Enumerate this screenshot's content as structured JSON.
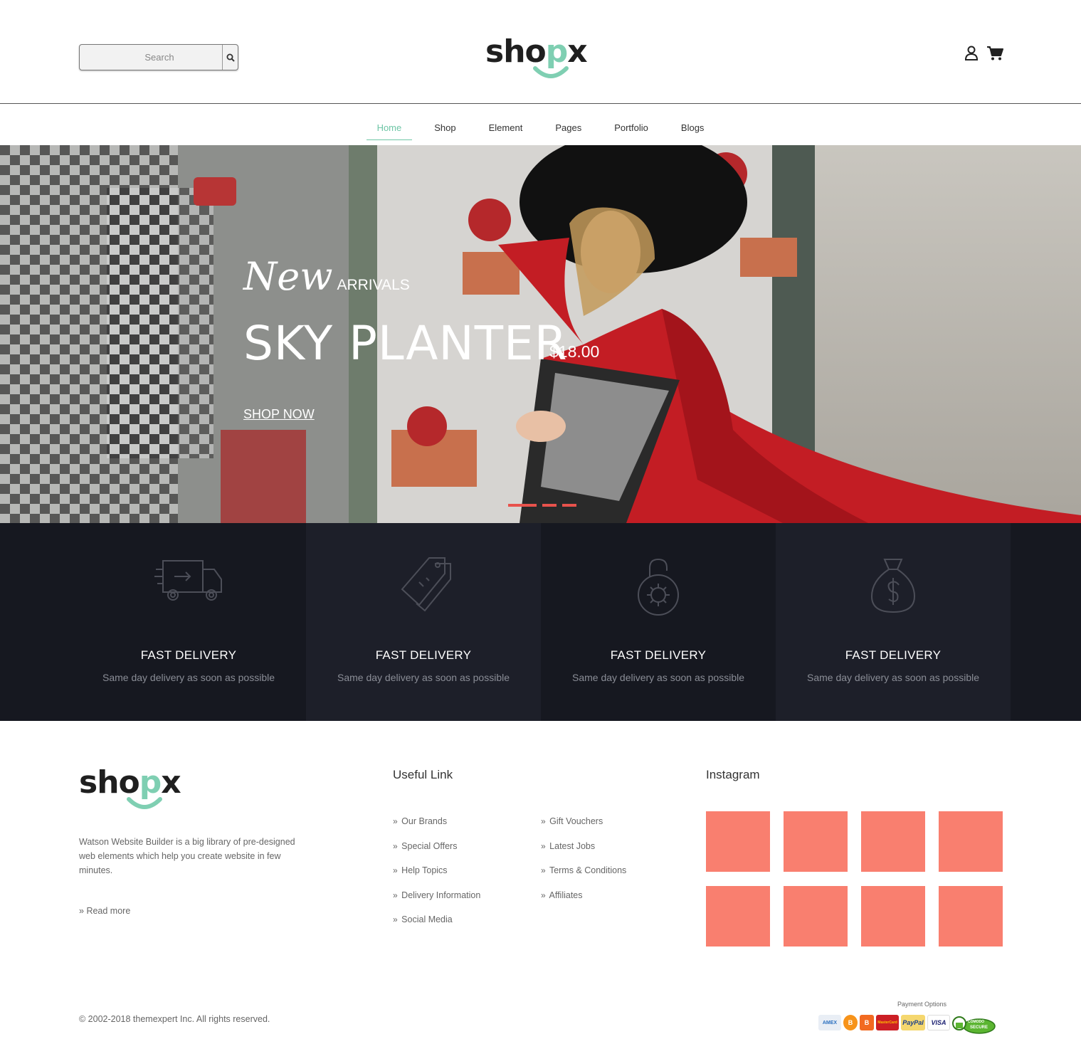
{
  "header": {
    "search_placeholder": "Search",
    "logo": {
      "text_main": "sho",
      "text_green": "p",
      "text_end": "x"
    }
  },
  "nav": {
    "items": [
      {
        "label": "Home",
        "active": true
      },
      {
        "label": "Shop"
      },
      {
        "label": "Element"
      },
      {
        "label": "Pages"
      },
      {
        "label": "Portfolio"
      },
      {
        "label": "Blogs"
      }
    ]
  },
  "hero": {
    "script_word": "New",
    "kicker": "ARRIVALS",
    "title": "SKY PLANTER",
    "price": "$18.00",
    "cta": "SHOP NOW",
    "slides": 3,
    "active_color": "#e8524c"
  },
  "features": [
    {
      "icon": "truck-icon",
      "title": "FAST DELIVERY",
      "desc": "Same day delivery as soon as possible"
    },
    {
      "icon": "tag-icon",
      "title": "FAST DELIVERY",
      "desc": "Same day delivery as soon as possible"
    },
    {
      "icon": "padlock-icon",
      "title": "FAST DELIVERY",
      "desc": "Same day delivery as soon as possible"
    },
    {
      "icon": "money-bag-icon",
      "title": "FAST DELIVERY",
      "desc": "Same day delivery as soon as possible"
    }
  ],
  "footer": {
    "about": "Watson Website Builder is a big library of pre-designed web elements which help you create website in few minutes.",
    "read_more": "Read more",
    "useful_title": "Useful Link",
    "links_col1": [
      "Our Brands",
      "Special Offers",
      "Help Topics",
      "Delivery Information",
      "Social Media"
    ],
    "links_col2": [
      "Gift Vouchers",
      "Latest Jobs",
      "Terms & Conditions",
      "Affiliates"
    ],
    "instagram_title": "Instagram",
    "instagram_tiles": 8,
    "tile_color": "#f97f6f",
    "copyright": "© 2002-2018 themexpert Inc. All rights reserved.",
    "payment_label": "Payment Options",
    "payment_methods": [
      "AMEX",
      "B",
      "B",
      "MasterCard",
      "PayPal",
      "VISA"
    ],
    "badge_text_1": "COMODO",
    "badge_text_2": "SECURE"
  },
  "colors": {
    "accent_green": "#6ec6a6",
    "features_bg": "#161820",
    "features_alt_bg": "#1d1f29"
  }
}
